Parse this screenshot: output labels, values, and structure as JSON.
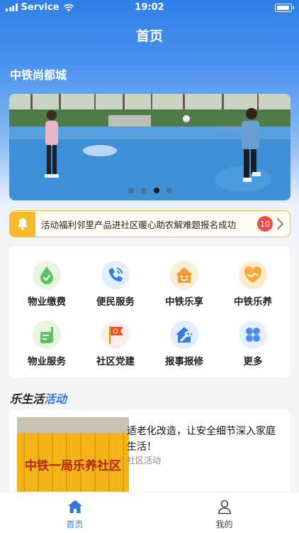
{
  "status_bar": {
    "carrier": "Service",
    "time": "19:02"
  },
  "header": {
    "title": "首页"
  },
  "community": {
    "name": "中铁尚都城"
  },
  "banner": {
    "page_count": 4,
    "active_index": 2
  },
  "notice": {
    "text": "活动福利邻里产品进社区暖心助农解难题报名成功",
    "badge_count": "10"
  },
  "services": [
    {
      "label": "物业缴费",
      "icon": "property-fee-icon",
      "color": "#5cc160"
    },
    {
      "label": "便民服务",
      "icon": "convenience-service-icon",
      "color": "#2f7fe8"
    },
    {
      "label": "中铁乐享",
      "icon": "share-home-icon",
      "color": "#f29a2e"
    },
    {
      "label": "中铁乐养",
      "icon": "elderly-care-icon",
      "color": "#f3a93a"
    },
    {
      "label": "物业服务",
      "icon": "property-service-icon",
      "color": "#5cc160"
    },
    {
      "label": "社区党建",
      "icon": "party-building-icon",
      "color": "#e54a3a"
    },
    {
      "label": "报事报修",
      "icon": "repair-icon",
      "color": "#2f7fe8"
    },
    {
      "label": "更多",
      "icon": "more-icon",
      "color": "#4c8ff0"
    }
  ],
  "section": {
    "title_part1": "乐生活",
    "title_part2": "活动"
  },
  "article": {
    "title": "适老化改造，让安全细节深入家庭生活！",
    "tag": "社区活动",
    "image_sign_text": "中铁一局乐养社区"
  },
  "tabbar": {
    "tabs": [
      {
        "label": "首页",
        "icon": "home-icon",
        "active": true
      },
      {
        "label": "我的",
        "icon": "user-icon",
        "active": false
      }
    ]
  },
  "colors": {
    "primary": "#2f78dc",
    "notice_border": "#f0c040",
    "badge": "#ee4b4b"
  }
}
